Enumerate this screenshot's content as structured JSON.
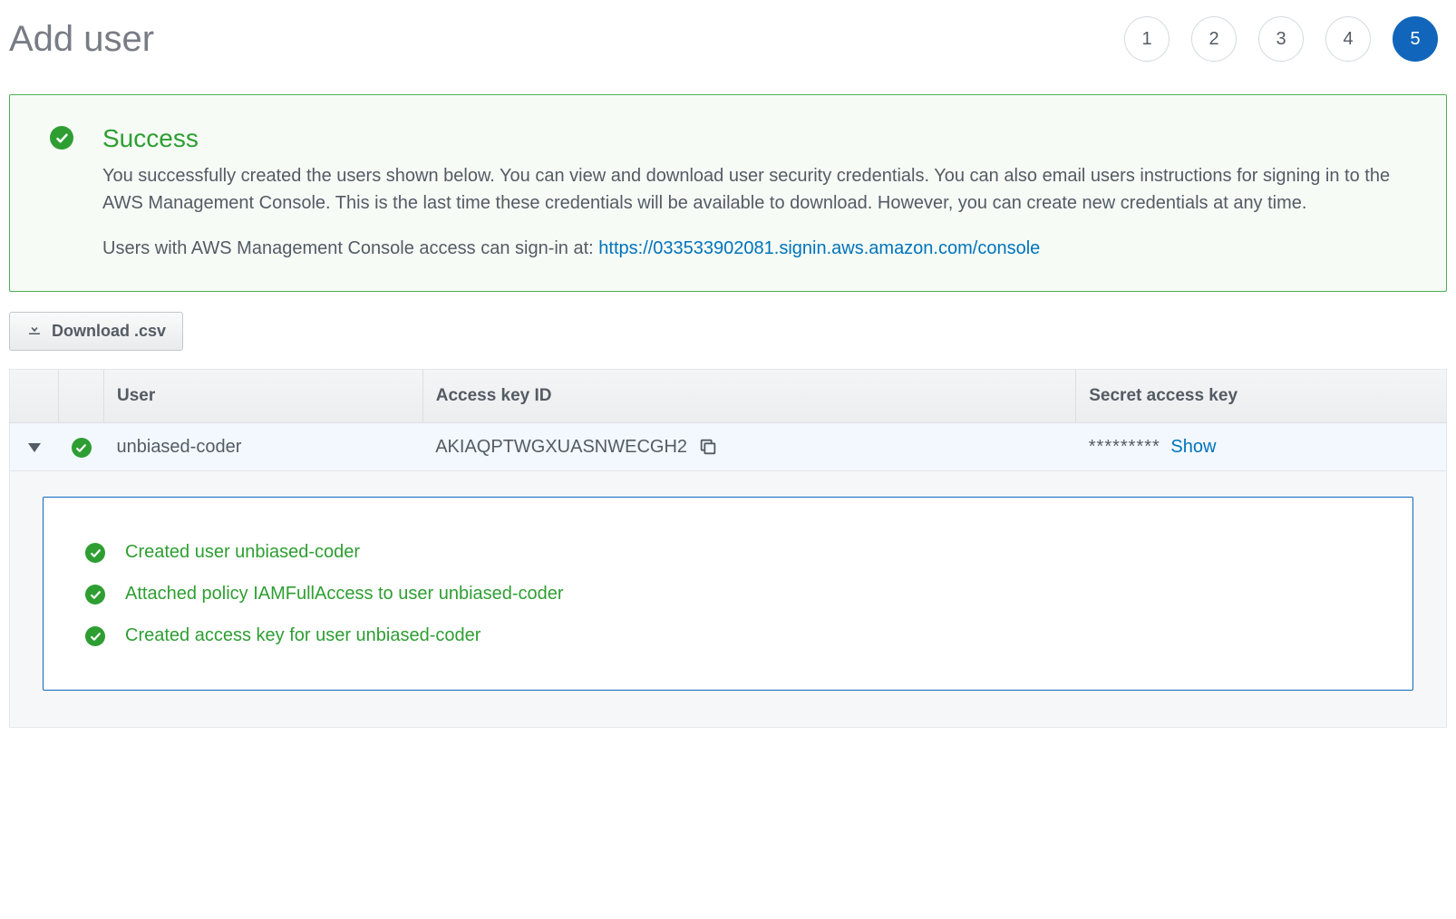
{
  "page_title": "Add user",
  "steps": [
    "1",
    "2",
    "3",
    "4",
    "5"
  ],
  "active_step_index": 4,
  "success": {
    "title": "Success",
    "paragraph1": "You successfully created the users shown below. You can view and download user security credentials. You can also email users instructions for signing in to the AWS Management Console. This is the last time these credentials will be available to download. However, you can create new credentials at any time.",
    "paragraph2_prefix": "Users with AWS Management Console access can sign-in at: ",
    "signin_url": "https://033533902081.signin.aws.amazon.com/console"
  },
  "download_button_label": "Download .csv",
  "table": {
    "headers": {
      "user": "User",
      "access_key_id": "Access key ID",
      "secret_access_key": "Secret access key"
    },
    "row": {
      "username": "unbiased-coder",
      "access_key_id": "AKIAQPTWGXUASNWECGH2",
      "secret_masked": "*********",
      "show_label": "Show"
    }
  },
  "details": [
    "Created user unbiased-coder",
    "Attached policy IAMFullAccess to user unbiased-coder",
    "Created access key for user unbiased-coder"
  ]
}
